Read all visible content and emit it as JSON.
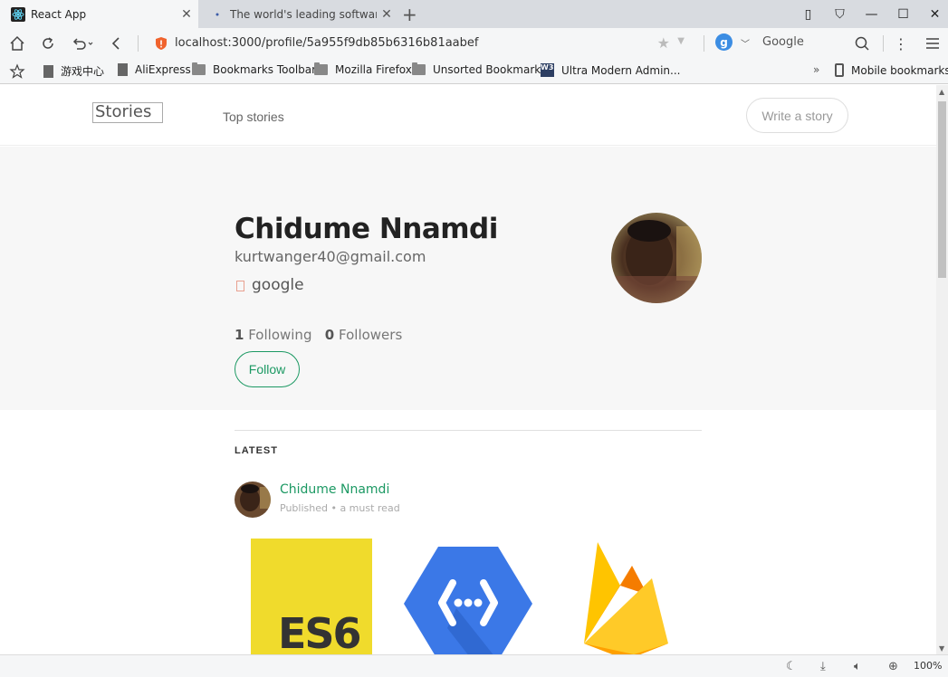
{
  "browser": {
    "tabs": [
      {
        "title": "React App",
        "active": true
      },
      {
        "title": "The world's leading software d",
        "active": false
      }
    ],
    "new_tab_label": "+",
    "url": "localhost:3000/profile/5a955f9db85b6316b81aabef",
    "search_engine_letter": "g",
    "search_placeholder": "Google",
    "bookmarks": [
      {
        "label": "游戏中心",
        "icon": "page-icon"
      },
      {
        "label": "AliExpress",
        "icon": "page-icon"
      },
      {
        "label": "Bookmarks Toolbar",
        "icon": "folder-icon"
      },
      {
        "label": "Mozilla Firefox",
        "icon": "folder-icon"
      },
      {
        "label": "Unsorted Bookmarks",
        "icon": "folder-icon"
      },
      {
        "label": "Ultra Modern Admin...",
        "icon": "w3-icon"
      }
    ],
    "bookmarks_overflow": "»",
    "mobile_bookmarks": "Mobile bookmarks",
    "zoom": "100%"
  },
  "site": {
    "logo_alt": "Stories",
    "nav_top_stories": "Top stories",
    "write_story": "Write a story"
  },
  "profile": {
    "name": "Chidume Nnamdi",
    "email": "kurtwanger40@gmail.com",
    "provider": "google",
    "following_count": "1",
    "following_label": "Following",
    "followers_count": "0",
    "followers_label": "Followers",
    "follow_button": "Follow"
  },
  "feed": {
    "section_title": "LATEST",
    "post": {
      "author": "Chidume Nnamdi",
      "meta": "Published • a must read",
      "images": [
        "ES6",
        "cloud-functions-logo",
        "firebase-logo"
      ]
    }
  },
  "colors": {
    "accent": "#1c9963",
    "es6_yellow": "#f0db2c",
    "gcf_blue": "#3b78e7",
    "firebase_orange": "#ffa000"
  }
}
